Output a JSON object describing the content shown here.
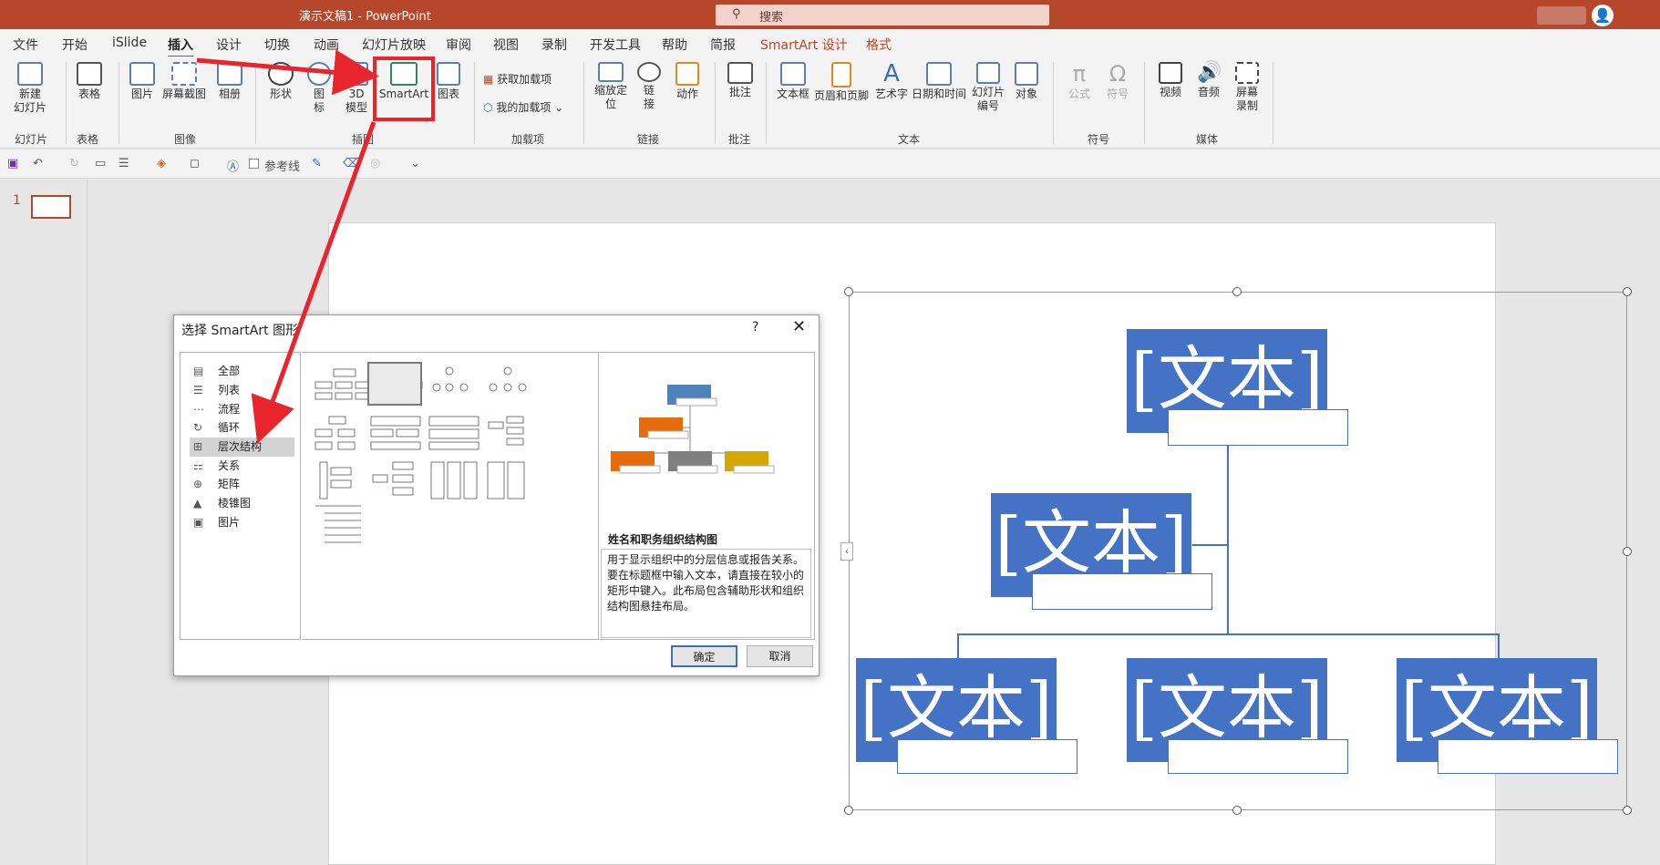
{
  "titlebar": {
    "title": "演示文稿1  -  PowerPoint",
    "search_placeholder": "搜索"
  },
  "menu": [
    "文件",
    "开始",
    "iSlide",
    "插入",
    "设计",
    "切换",
    "动画",
    "幻灯片放映",
    "审阅",
    "视图",
    "录制",
    "开发工具",
    "帮助",
    "简报",
    "SmartArt 设计",
    "格式"
  ],
  "ribbon": {
    "new_slide": "新建\n幻灯片",
    "table": "表格",
    "picture": "图片",
    "screenshot": "屏幕截图",
    "album": "相册",
    "shapes": "形状",
    "icons": "图\n标",
    "model3d": "3D\n模型",
    "smartart": "SmartArt",
    "chart": "图表",
    "get_addins": "获取加载项",
    "my_addins": "我的加载项",
    "zoom": "缩放定\n位",
    "link": "链\n接",
    "action": "动作",
    "comment": "批注",
    "textbox": "文本框",
    "header_footer": "页眉和页脚",
    "wordart": "艺术字",
    "datetime": "日期和时间",
    "slide_number": "幻灯片\n编号",
    "object": "对象",
    "equation": "公式",
    "symbol": "符号",
    "video": "视频",
    "audio": "音频",
    "screen_record": "屏幕\n录制",
    "groups": {
      "slides": "幻灯片",
      "tables": "表格",
      "images": "图像",
      "illustrations": "插图",
      "addins": "加载项",
      "links": "链接",
      "comments": "批注",
      "text": "文本",
      "symbols": "符号",
      "media": "媒体"
    }
  },
  "qat": {
    "guides": "参考线"
  },
  "thumbs": {
    "slide_number": "1"
  },
  "slide": {
    "placeholder": "[文本]"
  },
  "dialog": {
    "title": "选择 SmartArt 图形",
    "help": "?",
    "close": "✕",
    "categories": [
      "全部",
      "列表",
      "流程",
      "循环",
      "层次结构",
      "关系",
      "矩阵",
      "棱锥图",
      "图片"
    ],
    "selected_category": "层次结构",
    "preview_name": "姓名和职务组织结构图",
    "preview_desc": "用于显示组织中的分层信息或报告关系。要在标题框中输入文本，请直接在较小的矩形中键入。此布局包含辅助形状和组织结构图悬挂布局。",
    "ok": "确定",
    "cancel": "取消"
  }
}
